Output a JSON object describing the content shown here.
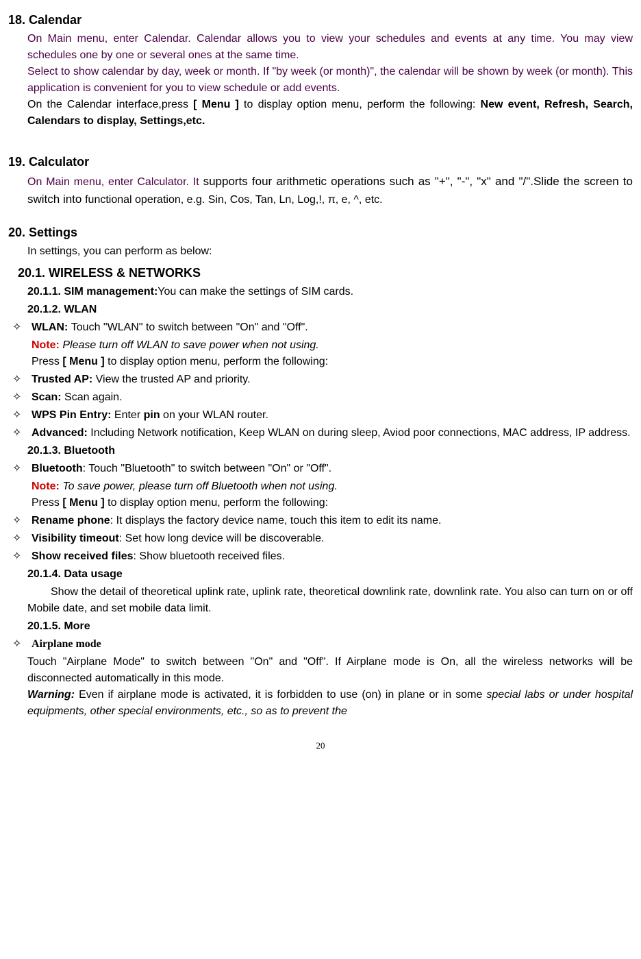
{
  "s18": {
    "num": "18.",
    "title": "Calendar",
    "p1a": "On Main menu, enter Calendar. Calendar allows you to view your schedules and events at any time. You may view schedules one by one or several ones at the same time.",
    "p1b": "Select to show calendar by day, week or month. If \"by week (or month)\", the calendar will be shown by week (or month). This application is convenient for you to view schedule or add events.",
    "p2a": "  On the Calendar interface,press ",
    "p2b": "[ Menu ]",
    "p2c": " to display option menu, perform the following: ",
    "p2d": "New event, Refresh, Search, Calendars to display, Settings,etc."
  },
  "s19": {
    "num": "19.",
    "title": "Calculator",
    "p1a": "On Main menu, enter Calculator. It ",
    "p1b": "supports four arithmetic operations such as \"+\", \"-\", \"x\" and \"/\".Slide the screen to switch into ",
    "p1c": "functional operation, e.g. Sin, Cos, Tan, Ln, Log,!, π, e, ^, etc."
  },
  "s20": {
    "num": "20.",
    "title": "Settings",
    "intro": "In settings, you can perform as below:",
    "h201": "20.1. WIRELESS & NETWORKS",
    "h2011": "20.1.1.  SIM management:",
    "t2011": "You can make the settings of SIM cards.",
    "h2012": "20.1.2.  WLAN",
    "wlan_b": "WLAN: ",
    "wlan_t": "Touch \"WLAN\" to switch between \"On\" and \"Off\".",
    "note_lbl": "Note:",
    "wlan_note": " Please turn off WLAN to save power when not using.",
    "press_a": "Press ",
    "press_menu": "[ Menu ]",
    "press_b": " to display option menu, perform the following:",
    "trusted_b": "Trusted AP: ",
    "trusted_t": "View the trusted AP and priority.",
    "scan_b": "Scan: ",
    "scan_t": "Scan again.",
    "wps_b": "WPS Pin Entry: ",
    "wps_t1": "Enter ",
    "wps_pin": "pin",
    "wps_t2": " on your WLAN router.",
    "adv_b": "Advanced: ",
    "adv_t": "Including Network notification, Keep WLAN on during sleep, Aviod poor connections, MAC address, IP address.",
    "h2013": "20.1.3.  Bluetooth",
    "bt_b": "Bluetooth",
    "bt_t": ": Touch \"Bluetooth\" to switch between \"On\" or \"Off\".",
    "bt_note": " To save power, please turn off Bluetooth when not using.",
    "rename_b": "Rename phone",
    "rename_t": ": It displays the factory device name, touch this item to edit its name.",
    "vis_b": "Visibility timeout",
    "vis_t": ": Set how long device will be discoverable.",
    "show_b": "Show received files",
    "show_t": ": Show bluetooth received files.",
    "h2014": "20.1.4.  Data usage",
    "data_t": "Show the detail of theoretical uplink rate, uplink rate, theoretical downlink rate, downlink rate. You also can turn on or off Mobile date, and set mobile data limit.",
    "h2015": "20.1.5.  More",
    "air_b": "Airplane mode",
    "air_t": "Touch \"Airplane Mode\" to switch between \"On\" and \"Off\". If Airplane mode is On, all the wireless networks will be disconnected automatically in this mode.",
    "warn_b": "Warning:",
    "warn_t1": " Even if airplane mode is activated, it is forbidden to use (on) in plane or in some ",
    "warn_t2": "special labs or under hospital equipments, other special environments, etc., so as to prevent the"
  },
  "page": "20"
}
